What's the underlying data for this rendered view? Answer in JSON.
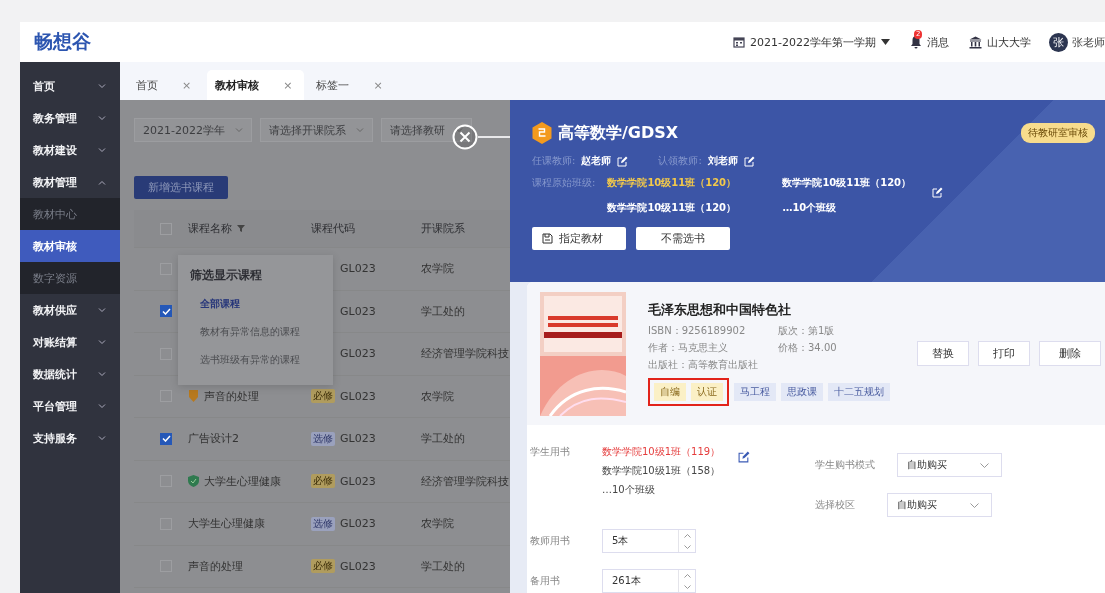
{
  "header": {
    "logo": "畅想谷",
    "term": "2021-2022学年第一学期",
    "messages": {
      "label": "消息",
      "badge": "2"
    },
    "school": "山大大学",
    "user": {
      "avatar": "张",
      "name": "张老师"
    }
  },
  "sidebar": {
    "items": [
      {
        "label": "首页",
        "expanded": false
      },
      {
        "label": "教务管理",
        "expanded": false
      },
      {
        "label": "教材建设",
        "expanded": false
      },
      {
        "label": "教材管理",
        "expanded": true,
        "children": [
          {
            "label": "教材中心",
            "selected": false
          },
          {
            "label": "教材审核",
            "selected": true
          },
          {
            "label": "数字资源",
            "selected": false
          }
        ]
      },
      {
        "label": "教材供应",
        "expanded": false
      },
      {
        "label": "对账结算",
        "expanded": false
      },
      {
        "label": "数据统计",
        "expanded": false
      },
      {
        "label": "平台管理",
        "expanded": false
      },
      {
        "label": "支持服务",
        "expanded": false
      }
    ]
  },
  "tabs": [
    {
      "label": "首页",
      "selected": false,
      "close": "×"
    },
    {
      "label": "教材审核",
      "selected": true,
      "close": "×"
    },
    {
      "label": "标签一",
      "selected": false,
      "close": "×"
    }
  ],
  "filters": {
    "selects": [
      "2021-2022学年",
      "请选择开课院系",
      "请选择教研"
    ],
    "add_button": "新增选书课程"
  },
  "table": {
    "all_checked": false,
    "columns": [
      "课程名称",
      "课程代码",
      "开课院系"
    ],
    "rows": [
      {
        "checked": false,
        "code": "GL023",
        "dept": "农学院"
      },
      {
        "checked": true,
        "code": "GL023",
        "dept": "学工处的"
      },
      {
        "checked": false,
        "code": "GL023",
        "dept": "经济管理学院科技"
      },
      {
        "checked": false,
        "icon": {
          "kind": "medal"
        },
        "name": "声音的处理",
        "tag": {
          "label": "必修",
          "kind": "required"
        },
        "code": "GL023",
        "dept": "农学院"
      },
      {
        "checked": true,
        "name": "广告设计2",
        "tag": {
          "label": "选修",
          "kind": "elective"
        },
        "code": "GL023",
        "dept": "学工处的"
      },
      {
        "checked": false,
        "icon": {
          "kind": "shield"
        },
        "name": "大学生心理健康",
        "tag": {
          "label": "必修",
          "kind": "required"
        },
        "code": "GL023",
        "dept": "经济管理学院科技"
      },
      {
        "checked": false,
        "name": "大学生心理健康",
        "tag": {
          "label": "选修",
          "kind": "elective"
        },
        "code": "GL023",
        "dept": "农学院"
      },
      {
        "checked": false,
        "name": "声音的处理",
        "tag": {
          "label": "必修",
          "kind": "required"
        },
        "code": "GL023",
        "dept": "学工处的"
      }
    ]
  },
  "filter_popup": {
    "title": "筛选显示课程",
    "options": [
      {
        "label": "全部课程",
        "selected": true
      },
      {
        "label": "教材有异常信息的课程",
        "selected": false
      },
      {
        "label": "选书班级有异常的课程",
        "selected": false
      }
    ]
  },
  "drawer": {
    "title": "高等数学/GDSX",
    "status": "待教研室审核",
    "teachers": [
      {
        "label": "任课教师:",
        "name": "赵老师"
      },
      {
        "label": "认领教师:",
        "name": "刘老师"
      }
    ],
    "classes_label": "课程原始班级:",
    "classes": [
      {
        "text": "数学学院10级11班（120）",
        "highlight": true
      },
      {
        "text": "数学学院10级11班（120）",
        "highlight": false
      },
      {
        "text": "数学学院10级11班（120）",
        "highlight": false
      },
      {
        "text": "…10个班级",
        "highlight": false
      }
    ],
    "buttons": [
      {
        "label": "指定教材",
        "kind": "icon"
      },
      {
        "label": "不需选书",
        "kind": "plain"
      }
    ],
    "book": {
      "title": "毛泽东思想和中国特色社",
      "details": [
        "ISBN：9256189902",
        "版次：第1版",
        "作者：马克思主义",
        "价格：34.00",
        "出版社：高等教育出版社"
      ],
      "tags": [
        {
          "label": "自编",
          "kind": "yellow"
        },
        {
          "label": "认证",
          "kind": "yellow"
        },
        {
          "label": "马工程",
          "kind": "blue"
        },
        {
          "label": "思政课",
          "kind": "blue"
        },
        {
          "label": "十二五规划",
          "kind": "blue"
        }
      ],
      "actions": [
        "替换",
        "打印",
        "删除"
      ]
    },
    "form": {
      "student_books": {
        "label": "学生用书",
        "classes": [
          {
            "text": "数学学院10级1班（119）",
            "warning": true
          },
          {
            "text": "数学学院10级1班（158）",
            "warning": false
          },
          {
            "text": "…10个班级",
            "warning": false
          }
        ]
      },
      "purchase_mode": {
        "label": "学生购书模式",
        "value": "自助购买"
      },
      "teacher_books": {
        "label": "教师用书",
        "value": "5本"
      },
      "campus": {
        "label": "选择校区",
        "value": "自助购买"
      },
      "spare_books": {
        "label": "备用书",
        "value": "261本"
      }
    }
  }
}
